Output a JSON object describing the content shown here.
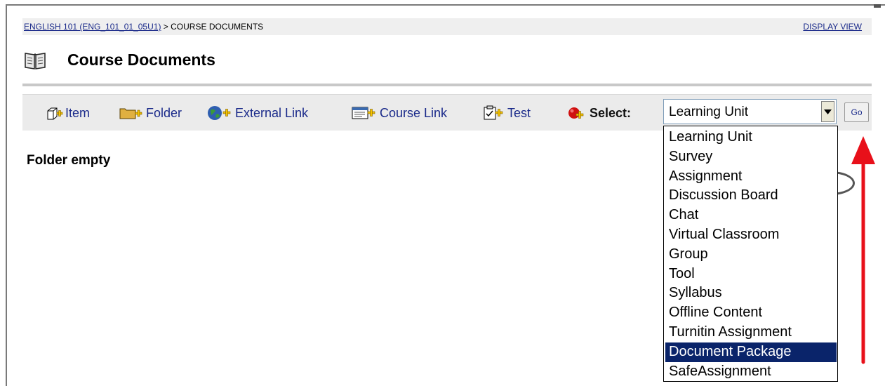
{
  "breadcrumb": {
    "course_link": "ENGLISH 101 (ENG_101_01_05U1)",
    "separator": " > ",
    "current": "COURSE DOCUMENTS"
  },
  "display_view": "DISPLAY VIEW",
  "page": {
    "title": "Course Documents",
    "title_icon": "book-icon"
  },
  "toolbar": {
    "item": "Item",
    "folder": "Folder",
    "external_link": "External Link",
    "course_link": "Course Link",
    "test": "Test",
    "select_label": "Select:"
  },
  "select": {
    "value": "Learning Unit",
    "go": "Go",
    "options": [
      "Learning Unit",
      "Survey",
      "Assignment",
      "Discussion Board",
      "Chat",
      "Virtual Classroom",
      "Group",
      "Tool",
      "Syllabus",
      "Offline Content",
      "Turnitin Assignment",
      "Document Package",
      "SafeAssignment"
    ],
    "highlighted": "Document Package"
  },
  "content": {
    "empty_message": "Folder empty"
  },
  "colors": {
    "link": "#1a2a8a",
    "highlight": "#0a246a",
    "arrow": "#e8101a",
    "toolbar_bg": "#ebebeb"
  }
}
